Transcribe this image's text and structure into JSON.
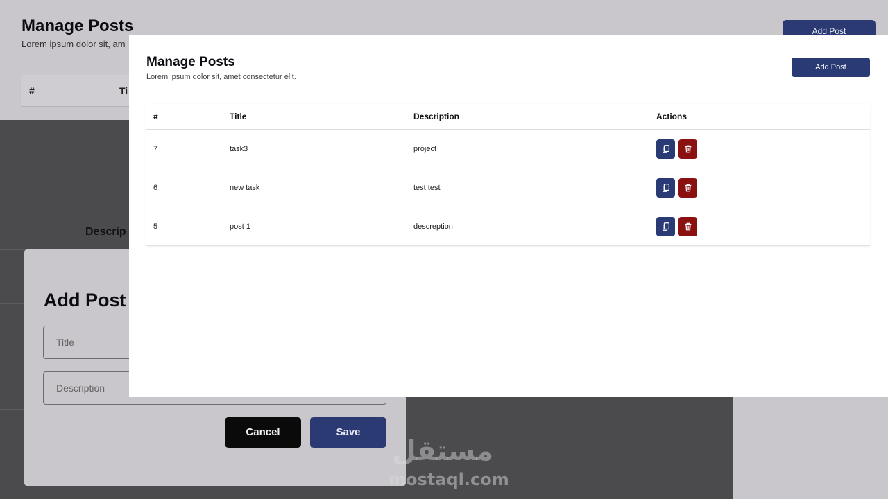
{
  "background": {
    "title": "Manage Posts",
    "subtitle": "Lorem ipsum dolor sit, am",
    "add_button": "Add Post",
    "table_headers": {
      "id": "#",
      "title": "Ti"
    },
    "description_label": "Descrip"
  },
  "add_modal": {
    "title": "Add Post",
    "title_placeholder": "Title",
    "description_placeholder": "Description",
    "cancel_label": "Cancel",
    "save_label": "Save"
  },
  "panel": {
    "title": "Manage Posts",
    "subtitle": "Lorem ipsum dolor sit, amet consectetur elit.",
    "add_button": "Add Post",
    "headers": {
      "id": "#",
      "title": "Title",
      "description": "Description",
      "actions": "Actions"
    },
    "rows": [
      {
        "id": "7",
        "title": "task3",
        "description": "project"
      },
      {
        "id": "6",
        "title": "new task",
        "description": "test test"
      },
      {
        "id": "5",
        "title": "post 1",
        "description": "descreption"
      }
    ]
  },
  "watermark": {
    "logo": "مستقل",
    "url": "mostaql.com"
  },
  "colors": {
    "primary": "#293a74",
    "danger": "#8b1010",
    "overlay": "#4b4b4d"
  },
  "icons": {
    "edit": "copy-icon",
    "delete": "trash-icon"
  }
}
